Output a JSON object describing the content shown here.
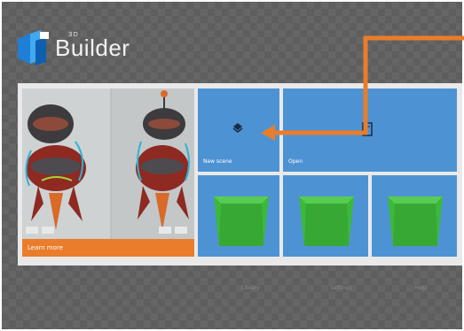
{
  "app": {
    "brand": "3D",
    "title": "Builder"
  },
  "hero": {
    "label": "Learn more"
  },
  "tiles": {
    "new_scene": {
      "label": "New scene",
      "icon": "new-scene-icon"
    },
    "open": {
      "label": "Open",
      "icon": "open-file-icon"
    }
  },
  "recent_models": [
    {
      "icon": "cube-icon",
      "color": "#3cb83a"
    },
    {
      "icon": "cube-icon",
      "color": "#3cb83a"
    },
    {
      "icon": "cube-icon",
      "color": "#3cb83a"
    }
  ],
  "footer": {
    "links": [
      "Library",
      "Settings",
      "Help"
    ]
  },
  "colors": {
    "accent_orange": "#ea7d2b",
    "tile_blue": "#4d93d3",
    "cube_green": "#3cb83a"
  }
}
